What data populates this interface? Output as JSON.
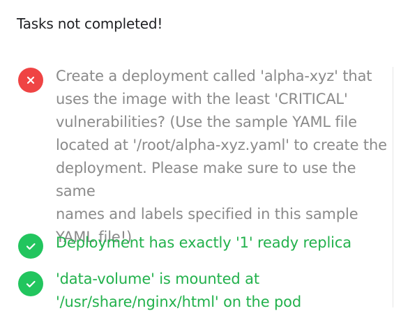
{
  "header": {
    "title": "Tasks not completed!"
  },
  "tasks": [
    {
      "status": "failed",
      "icon": "x-icon",
      "text": "Create a deployment called 'alpha-xyz' that\nuses the image with the least 'CRITICAL'\nvulnerabilities? (Use the sample YAML file\nlocated at '/root/alpha-xyz.yaml' to create the\ndeployment. Please make sure to use the same\nnames and labels specified in this sample\nYAML file!)"
    },
    {
      "status": "passed",
      "icon": "check-icon",
      "text": "Deployment has exactly '1' ready replica"
    },
    {
      "status": "passed",
      "icon": "check-icon",
      "text": "'data-volume' is mounted at\n'/usr/share/nginx/html' on the pod"
    }
  ],
  "colors": {
    "fail": "#ef4444",
    "pass": "#22c55e",
    "fail_text": "#8a8a8a",
    "pass_text": "#22b14c",
    "title_text": "#1f2023"
  }
}
